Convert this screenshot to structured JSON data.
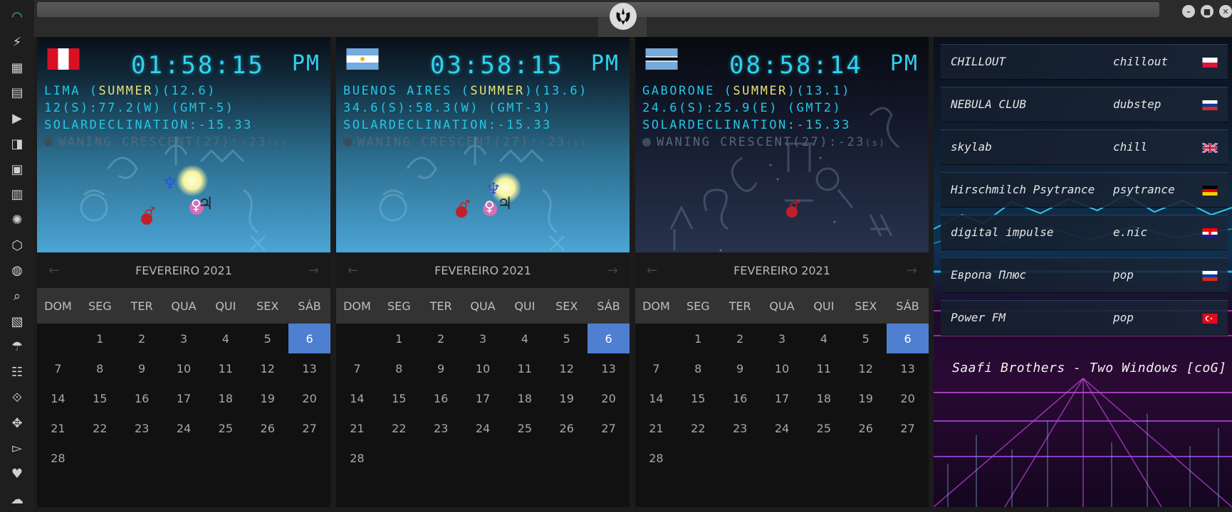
{
  "sidebar": {
    "icons": [
      "wifi-icon",
      "flash-icon",
      "windows-icon",
      "archive-icon",
      "play-icon",
      "map-book-icon",
      "image-icon",
      "news-icon",
      "rebel-icon",
      "hexagon-icon",
      "globe-icon",
      "search-icon",
      "map-icon",
      "umbrella-icon",
      "contacts-icon",
      "link-icon",
      "expand-icon",
      "youtube-icon",
      "heart-icon",
      "cloud-icon"
    ]
  },
  "window": {
    "minimize": "–",
    "maximize": "■",
    "close": "✕"
  },
  "clocks": [
    {
      "flag": "peru",
      "time": "01:58:15",
      "ampm": "PM",
      "city": "LIMA",
      "season": "SUMMER",
      "daylight": "12.6",
      "coords": "12(S):77.2(W)",
      "gmt": "(GMT-5)",
      "declination": "SOLARDECLINATION:-15.33",
      "moon": "WANING CRESCENT(27):-23",
      "moon_unit": "(s)",
      "sky": "day"
    },
    {
      "flag": "argentina",
      "time": "03:58:15",
      "ampm": "PM",
      "city": "BUENOS AIRES",
      "season": "SUMMER",
      "daylight": "13.6",
      "coords": "34.6(S):58.3(W)",
      "gmt": "(GMT-3)",
      "declination": "SOLARDECLINATION:-15.33",
      "moon": "WANING CRESCENT(27):-23",
      "moon_unit": "(s)",
      "sky": "day"
    },
    {
      "flag": "botswana",
      "time": "08:58:14",
      "ampm": "PM",
      "city": "GABORONE",
      "season": "SUMMER",
      "daylight": "13.1",
      "coords": "24.6(S):25.9(E)",
      "gmt": "(GMT2)",
      "declination": "SOLARDECLINATION:-15.33",
      "moon": "WANING CRESCENT(27):-23",
      "moon_unit": "(s)",
      "sky": "night"
    }
  ],
  "calendar": {
    "month": "FEVEREIRO 2021",
    "prev": "←",
    "next": "→",
    "weekdays": [
      "DOM",
      "SEG",
      "TER",
      "QUA",
      "QUI",
      "SEX",
      "SÁB"
    ],
    "leading_blanks": 1,
    "days": [
      "1",
      "2",
      "3",
      "4",
      "5",
      "6",
      "7",
      "8",
      "9",
      "10",
      "11",
      "12",
      "13",
      "14",
      "15",
      "16",
      "17",
      "18",
      "19",
      "20",
      "21",
      "22",
      "23",
      "24",
      "25",
      "26",
      "27",
      "28"
    ],
    "selected": "6"
  },
  "radio": {
    "stations": [
      {
        "name": "CHILLOUT",
        "genre": "chillout",
        "flag": "poland"
      },
      {
        "name": "NEBULA CLUB",
        "genre": "dubstep",
        "flag": "russia"
      },
      {
        "name": "skylab",
        "genre": "chill",
        "flag": "uk"
      },
      {
        "name": "Hirschmilch Psytrance",
        "genre": "psytrance",
        "flag": "germany"
      },
      {
        "name": "digital impulse",
        "genre": "e.nic",
        "flag": "croatia"
      },
      {
        "name": "Европа Плюс",
        "genre": "pop",
        "flag": "russia"
      },
      {
        "name": "Power FM",
        "genre": "pop",
        "flag": "turkey"
      }
    ],
    "now_playing": "Saafi Brothers - Two Windows [coG]"
  },
  "colors": {
    "accent": "#2fd3f0",
    "season": "#e8e07a",
    "calendar_selected": "#4f7fd0"
  }
}
